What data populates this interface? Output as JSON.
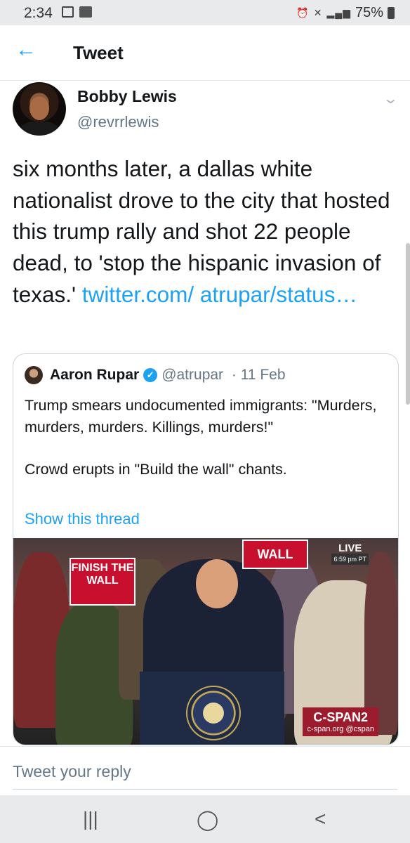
{
  "status_bar": {
    "time": "2:34",
    "battery": "75%"
  },
  "header": {
    "title": "Tweet",
    "back_icon": "arrow-left-icon"
  },
  "tweet": {
    "author_name": "Bobby Lewis",
    "author_handle": "@revrrlewis",
    "text": "six months later, a dallas white nationalist drove to the city that hosted this trump rally and shot 22 people dead, to 'stop the hispanic invasion of texas.' ",
    "link_text": "twitter.com/ atrupar/status…"
  },
  "quoted_tweet": {
    "author_name": "Aaron Rupar",
    "author_handle": "@atrupar",
    "date": "· 11 Feb",
    "text_line1": "Trump smears undocumented immigrants: \"Murders, murders, murders. Killings, murders!\"",
    "text_line2": "Crowd erupts in \"Build the wall\" chants.",
    "show_thread": "Show this thread",
    "image": {
      "sign_left": "FINISH THE WALL",
      "sign_top": "WALL",
      "live_label": "LIVE",
      "live_time": "6:59 pm PT",
      "network": "C-SPAN2",
      "network_sub": "c-span.org @cspan"
    }
  },
  "reply": {
    "placeholder": "Tweet your reply"
  },
  "accent_color": "#1da1f2"
}
